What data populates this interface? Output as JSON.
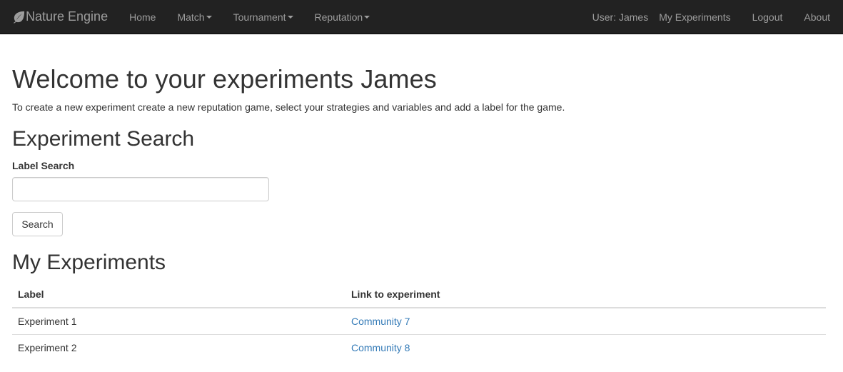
{
  "navbar": {
    "brand": "Nature Engine",
    "brand_icon": "leaf-icon",
    "left_items": [
      {
        "label": "Home",
        "dropdown": false
      },
      {
        "label": "Match",
        "dropdown": true
      },
      {
        "label": "Tournament",
        "dropdown": true
      },
      {
        "label": "Reputation",
        "dropdown": true
      }
    ],
    "user": "User: James",
    "my_experiments": "My Experiments",
    "logout": "Logout",
    "about": "About"
  },
  "main": {
    "title": "Welcome to your experiments James",
    "intro": "To create a new experiment create a new reputation game, select your strategies and variables and add a label for the game.",
    "search": {
      "heading": "Experiment Search",
      "label": "Label Search",
      "value": "",
      "placeholder": "",
      "button": "Search"
    },
    "experiments": {
      "heading": "My Experiments",
      "columns": [
        "Label",
        "Link to experiment"
      ],
      "rows": [
        {
          "label": "Experiment 1",
          "link": "Community 7"
        },
        {
          "label": "Experiment 2",
          "link": "Community 8"
        }
      ]
    }
  },
  "colors": {
    "navbar_bg": "#222222",
    "navbar_text": "#9d9d9d",
    "link": "#337ab7",
    "text": "#333333"
  }
}
